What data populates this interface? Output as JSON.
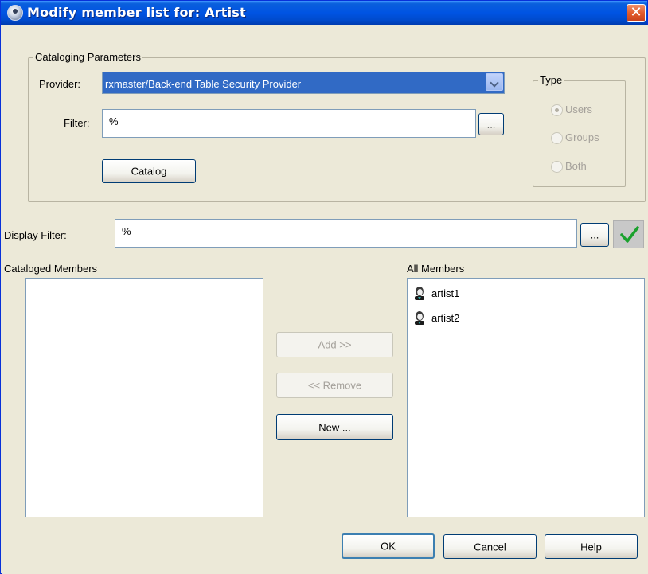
{
  "window": {
    "title": "Modify member list for: Artist",
    "close_glyph": "✕"
  },
  "cataloging": {
    "legend": "Cataloging Parameters",
    "provider_label": "Provider:",
    "provider_value": "rxmaster/Back-end Table Security Provider",
    "filter_label": "Filter:",
    "filter_value": "%",
    "browse_label": "...",
    "catalog_button": "Catalog"
  },
  "type": {
    "legend": "Type",
    "options": [
      {
        "label": "Users",
        "selected": true
      },
      {
        "label": "Groups",
        "selected": false
      },
      {
        "label": "Both",
        "selected": false
      }
    ]
  },
  "display_filter": {
    "label": "Display Filter:",
    "value": "%",
    "browse_label": "...",
    "apply_icon": "checkmark-icon",
    "apply_color": "#1aa12d"
  },
  "lists": {
    "cataloged_title": "Cataloged Members",
    "cataloged_items": [],
    "all_title": "All Members",
    "all_items": [
      {
        "label": "artist1",
        "icon": "user-icon"
      },
      {
        "label": "artist2",
        "icon": "user-icon"
      }
    ]
  },
  "actions": {
    "add": "Add >>",
    "remove": "<< Remove",
    "new": "New ..."
  },
  "footer": {
    "ok": "OK",
    "cancel": "Cancel",
    "help": "Help"
  }
}
